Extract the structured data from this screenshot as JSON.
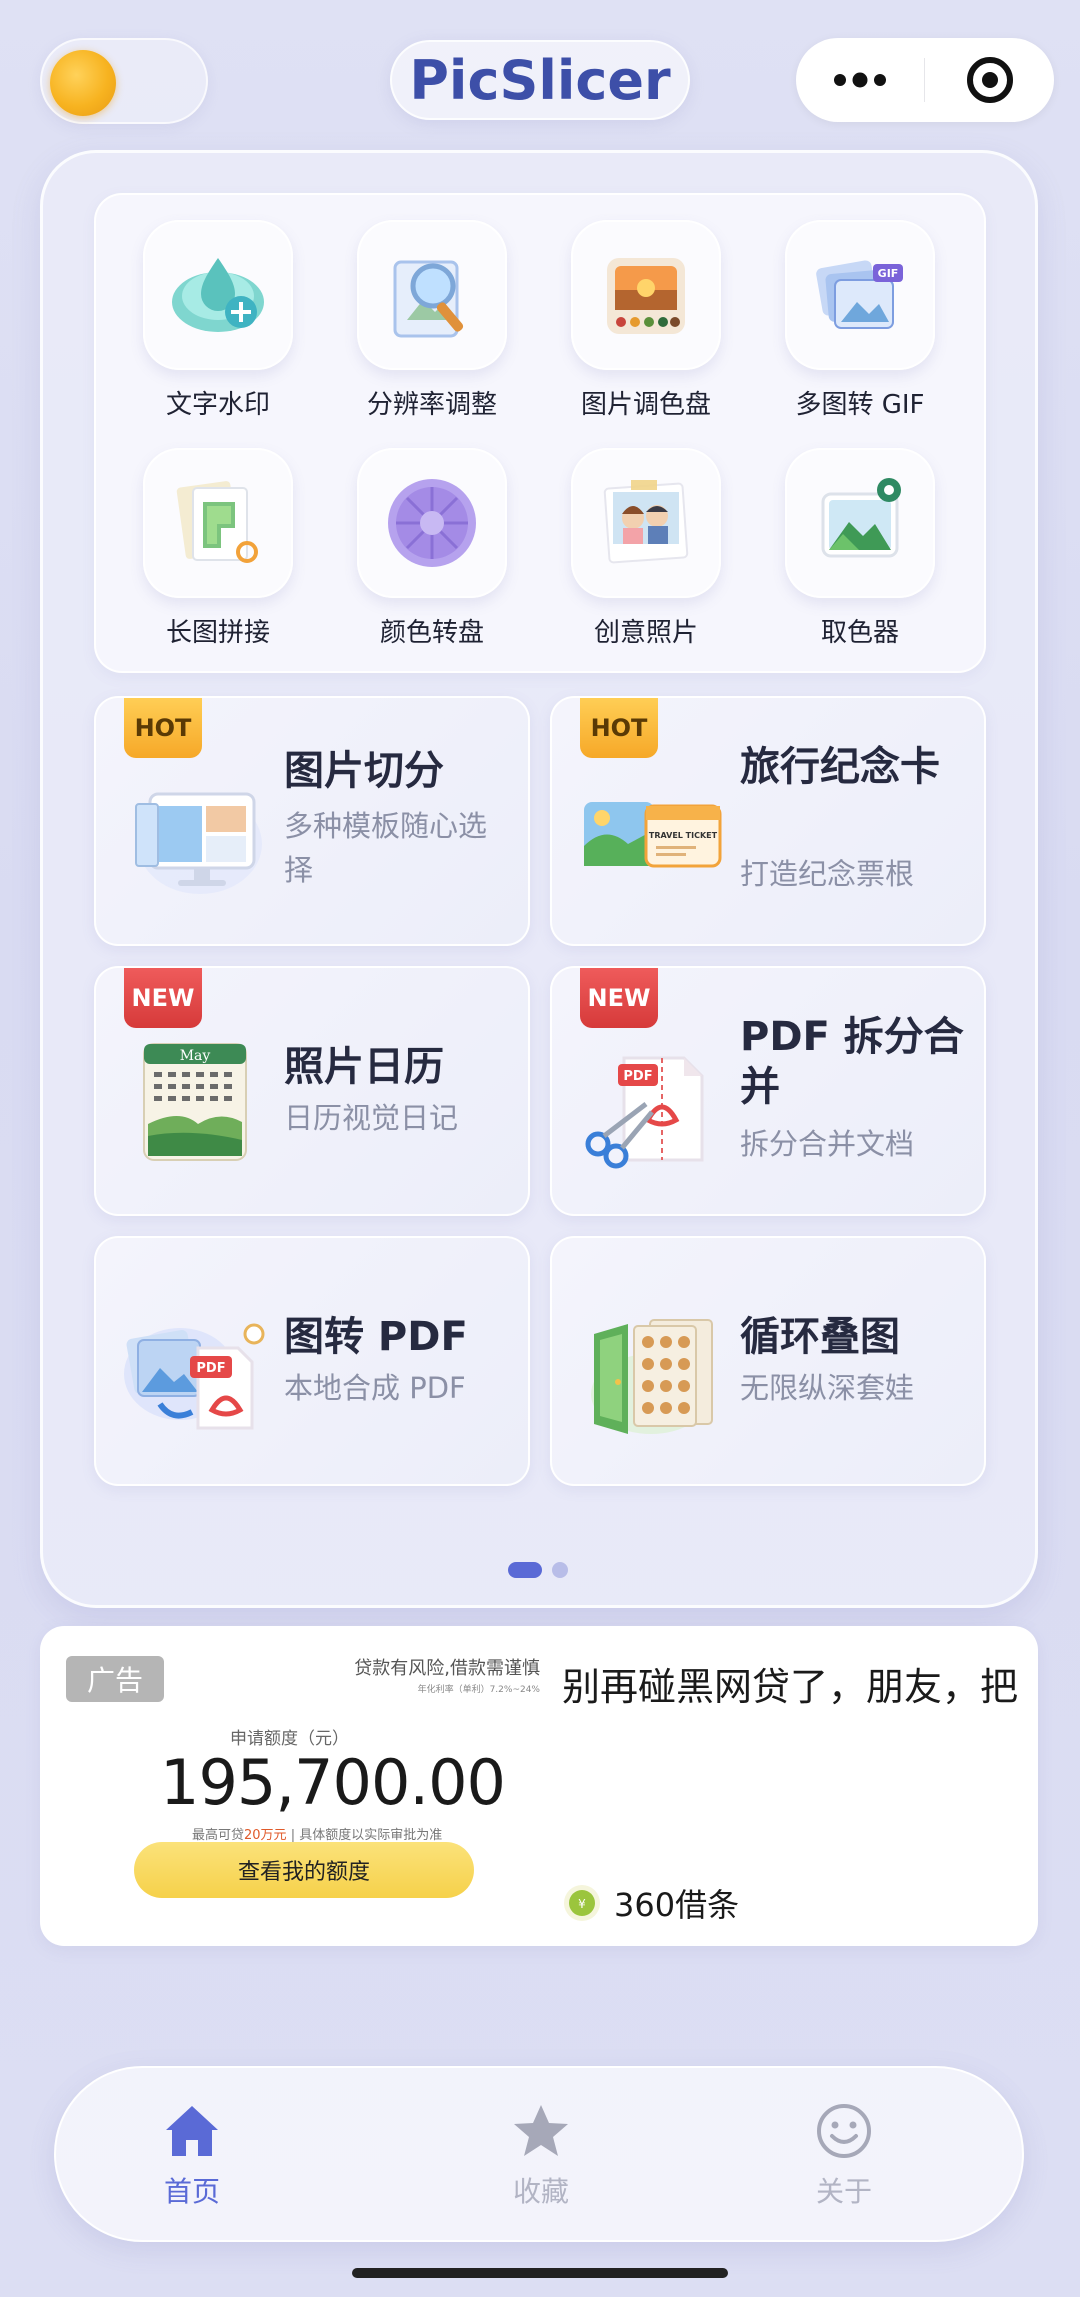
{
  "header": {
    "brand": "PicSlicer",
    "sun_icon": "sun-icon",
    "more_icon": "more-icon",
    "target_icon": "target-icon"
  },
  "tools": [
    {
      "label": "文字水印",
      "icon": "watermark-icon"
    },
    {
      "label": "分辨率调整",
      "icon": "resolution-icon"
    },
    {
      "label": "图片调色盘",
      "icon": "palette-icon"
    },
    {
      "label": "多图转 GIF",
      "icon": "gif-icon"
    },
    {
      "label": "长图拼接",
      "icon": "stitch-icon"
    },
    {
      "label": "颜色转盘",
      "icon": "color-wheel-icon"
    },
    {
      "label": "创意照片",
      "icon": "creative-photo-icon"
    },
    {
      "label": "取色器",
      "icon": "color-picker-icon"
    }
  ],
  "features": [
    {
      "badge": "HOT",
      "title": "图片切分",
      "subtitle": "多种模板随心选择",
      "icon": "monitor-slice-icon"
    },
    {
      "badge": "HOT",
      "title": "旅行纪念卡",
      "subtitle": "打造纪念票根",
      "icon": "travel-ticket-icon"
    },
    {
      "badge": "NEW",
      "title": "照片日历",
      "subtitle": "日历视觉日记",
      "calendar_month": "May",
      "icon": "calendar-icon"
    },
    {
      "badge": "NEW",
      "title": "PDF 拆分合并",
      "subtitle": "拆分合并文档",
      "pdf_tag": "PDF",
      "icon": "pdf-split-icon"
    },
    {
      "badge": "",
      "title": "图转 PDF",
      "subtitle": "本地合成 PDF",
      "pdf_tag": "PDF",
      "icon": "image-to-pdf-icon"
    },
    {
      "badge": "",
      "title": "循环叠图",
      "subtitle": "无限纵深套娃",
      "icon": "loop-stack-icon"
    }
  ],
  "pager": {
    "pages": 2,
    "active": 1
  },
  "ad": {
    "tag": "广告",
    "risk": "贷款有风险,借款需谨慎",
    "fine_print": "年化利率（单利）7.2%~24%",
    "amount_label": "申请额度（元）",
    "amount": "195,700.00",
    "amount_note_prefix": "最高可贷",
    "amount_note_highlight": "20万元",
    "amount_note_suffix": " | 具体额度以实际审批为准",
    "button": "查看我的额度",
    "headline": "别再碰黑网贷了，朋友，把",
    "brand": "360借条"
  },
  "tabbar": {
    "items": [
      {
        "label": "首页",
        "icon": "home-icon",
        "active": true
      },
      {
        "label": "收藏",
        "icon": "star-icon",
        "active": false
      },
      {
        "label": "关于",
        "icon": "smile-icon",
        "active": false
      }
    ],
    "active_color": "#5a6ad6",
    "inactive_color": "#b2b4c4"
  }
}
